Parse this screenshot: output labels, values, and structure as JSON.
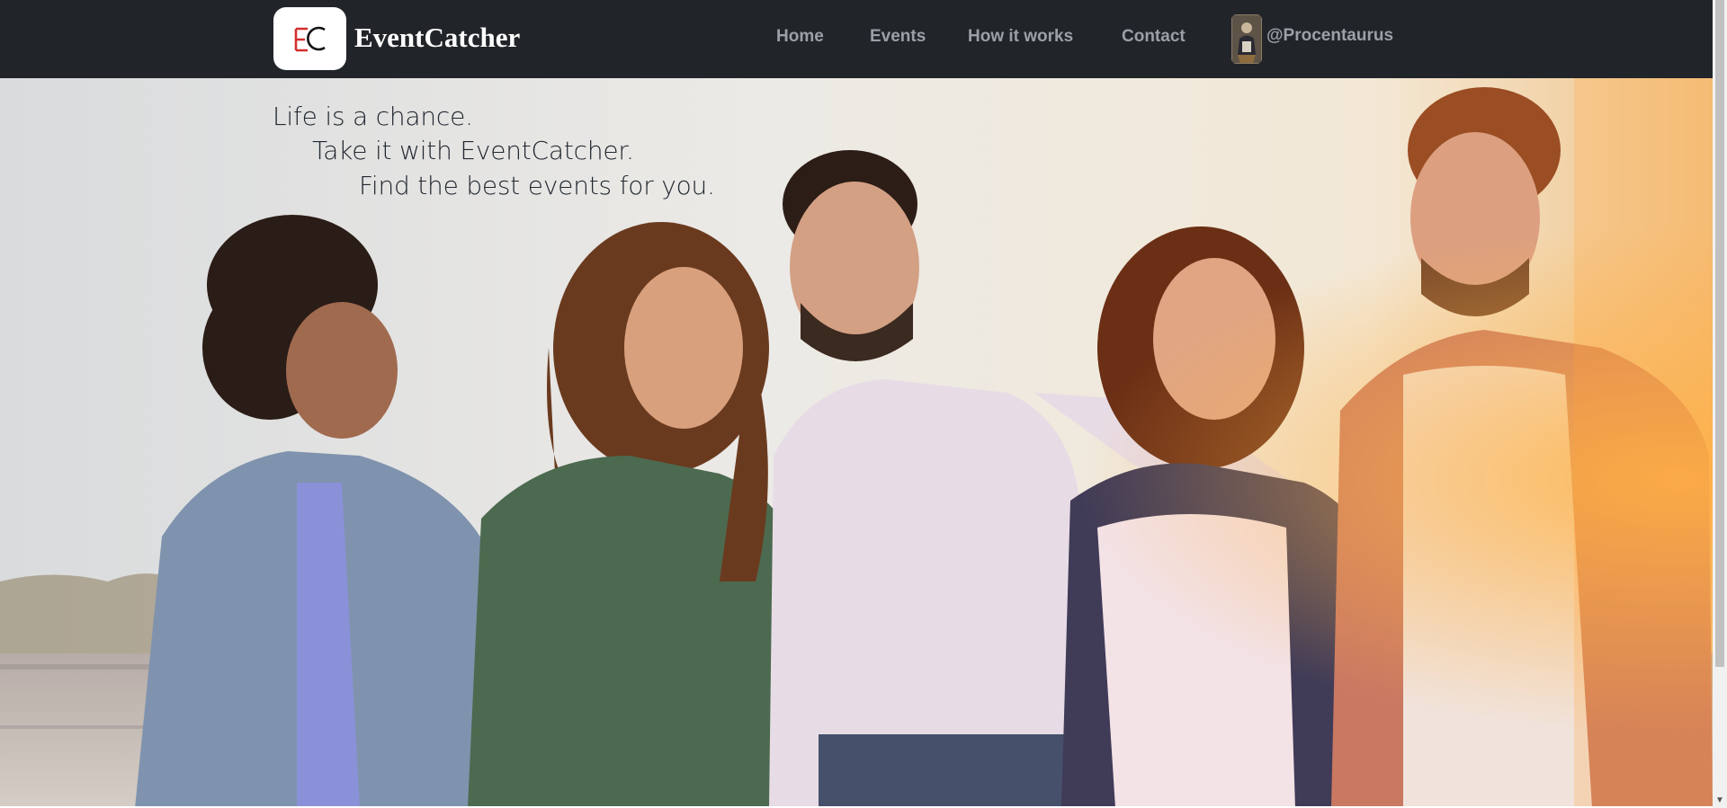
{
  "brand": {
    "logo_mark": "EC",
    "name": "EventCatcher"
  },
  "nav": {
    "items": [
      {
        "label": "Home"
      },
      {
        "label": "Events"
      },
      {
        "label": "How it works"
      },
      {
        "label": "Contact"
      }
    ],
    "user": {
      "handle": "@Procentaurus",
      "avatar_icon": "user-avatar-portrait"
    }
  },
  "hero": {
    "tagline": [
      "Life is a chance.",
      "Take it with EventCatcher.",
      "Find the best events for you."
    ],
    "image_description_icon": "group-of-friends-photo"
  },
  "colors": {
    "navbar_bg": "#212529",
    "nav_text": "#9aa0a6",
    "brand_text": "#ffffff",
    "logo_red": "#d32f2f",
    "tagline_text": "#222831"
  }
}
